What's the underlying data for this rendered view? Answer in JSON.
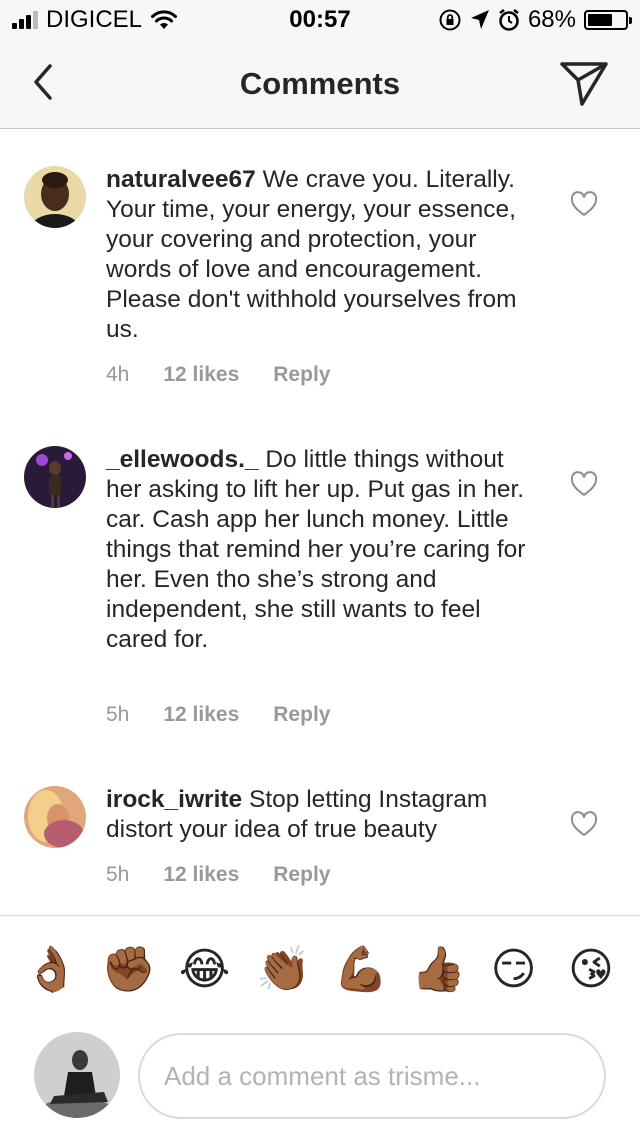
{
  "status_bar": {
    "carrier": "DIGICEL",
    "time": "00:57",
    "battery_percent": "68%",
    "battery_level": 0.68,
    "icons": [
      "signal-icon",
      "wifi-icon",
      "rotation-lock-icon",
      "location-icon",
      "alarm-icon",
      "battery-icon"
    ]
  },
  "nav": {
    "title": "Comments",
    "back_icon": "chevron-left-icon",
    "send_icon": "direct-send-icon"
  },
  "comments": [
    {
      "username": "naturalvee67",
      "text": " We crave you. Literally. Your time, your energy, your essence, your covering and protection, your words of love and encouragement. Please don't withhold yourselves from us.",
      "time": "4h",
      "likes": "12 likes",
      "reply": "Reply"
    },
    {
      "username": "_ellewoods._",
      "text": " Do little things without her asking to lift her up. Put gas in her. car. Cash app her lunch money. Little things that remind her you’re caring for her. Even tho she’s strong and independent, she still wants to feel cared for.",
      "time": "5h",
      "likes": "12 likes",
      "reply": "Reply"
    },
    {
      "username": "irock_iwrite",
      "text": " Stop letting Instagram distort your idea of true beauty",
      "time": "5h",
      "likes": "12 likes",
      "reply": "Reply"
    }
  ],
  "emoji_bar": {
    "emojis": [
      "👌🏾",
      "✊🏾",
      "😂",
      "👏🏾",
      "💪🏾",
      "👍🏾",
      "😏",
      "😘"
    ]
  },
  "composer": {
    "placeholder": "Add a comment as trisme..."
  }
}
